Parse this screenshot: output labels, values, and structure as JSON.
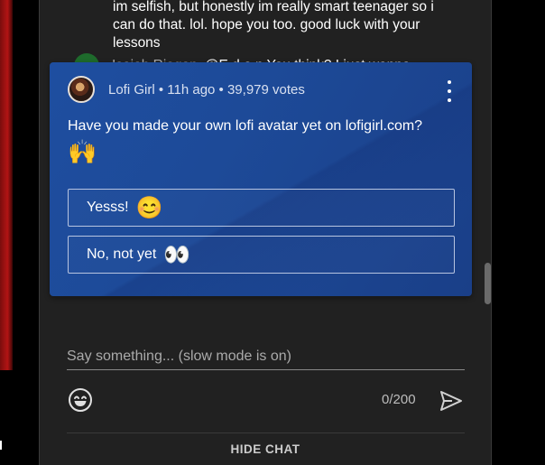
{
  "chat": {
    "messages": [
      {
        "text": "im selfish, but honestly im really smart teenager so i can do that. lol. hope you too. good luck with your lessons"
      },
      {
        "author": "Isaiah Riogan",
        "text": "@E d o n You think? I just wanna"
      }
    ]
  },
  "poll": {
    "meta": "Lofi Girl • 11h ago • 39,979 votes",
    "question": "Have you made your own lofi avatar yet on lofigirl.com?",
    "question_emoji": "🙌",
    "options": [
      {
        "label": "Yesss!",
        "emoji": "😊"
      },
      {
        "label": "No, not yet",
        "emoji": "👀"
      }
    ],
    "icons": {
      "menu": "more-vert-icon",
      "avatar": "channel-avatar"
    }
  },
  "input": {
    "placeholder": "Say something... (slow mode is on)",
    "char_count": "0/200",
    "icons": {
      "emoji": "emoji-icon",
      "send": "send-icon"
    }
  },
  "footer": {
    "hide_chat_label": "HIDE CHAT"
  },
  "colors": {
    "panel_bg": "#212121",
    "poll_bg": "#1e4ea0",
    "text": "#ffffff"
  }
}
